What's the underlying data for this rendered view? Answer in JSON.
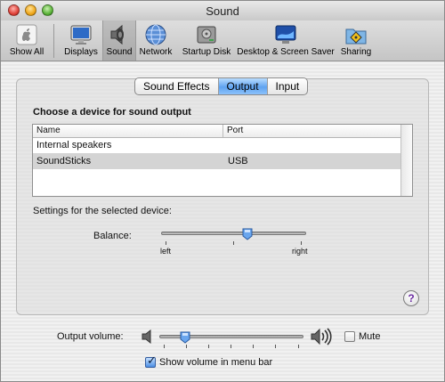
{
  "window": {
    "title": "Sound"
  },
  "toolbar": {
    "items": [
      {
        "label": "Show All",
        "icon": "apple-grid-icon"
      },
      {
        "label": "Displays",
        "icon": "display-icon"
      },
      {
        "label": "Sound",
        "icon": "speaker-icon",
        "selected": true
      },
      {
        "label": "Network",
        "icon": "globe-icon"
      },
      {
        "label": "Startup Disk",
        "icon": "hard-disk-icon"
      },
      {
        "label": "Desktop & Screen Saver",
        "icon": "desktop-icon"
      },
      {
        "label": "Sharing",
        "icon": "sharing-folder-icon"
      }
    ]
  },
  "tabs": [
    {
      "label": "Sound Effects",
      "active": false
    },
    {
      "label": "Output",
      "active": true
    },
    {
      "label": "Input",
      "active": false
    }
  ],
  "output": {
    "heading": "Choose a device for sound output",
    "columns": {
      "name": "Name",
      "port": "Port"
    },
    "devices": [
      {
        "name": "Internal speakers",
        "port": ""
      },
      {
        "name": "SoundSticks",
        "port": "USB",
        "selected": true
      }
    ],
    "settings_label": "Settings for the selected device:",
    "balance": {
      "label": "Balance:",
      "left_label": "left",
      "right_label": "right",
      "value": 0.6
    }
  },
  "help": {
    "label": "?"
  },
  "footer": {
    "output_volume_label": "Output volume:",
    "output_volume_value": 0.15,
    "mute_label": "Mute",
    "mute_checked": false,
    "show_volume_label": "Show volume in menu bar",
    "show_volume_checked": true
  },
  "colors": {
    "accent": "#5fa3f0",
    "selected_row": "#d4d4d4"
  }
}
